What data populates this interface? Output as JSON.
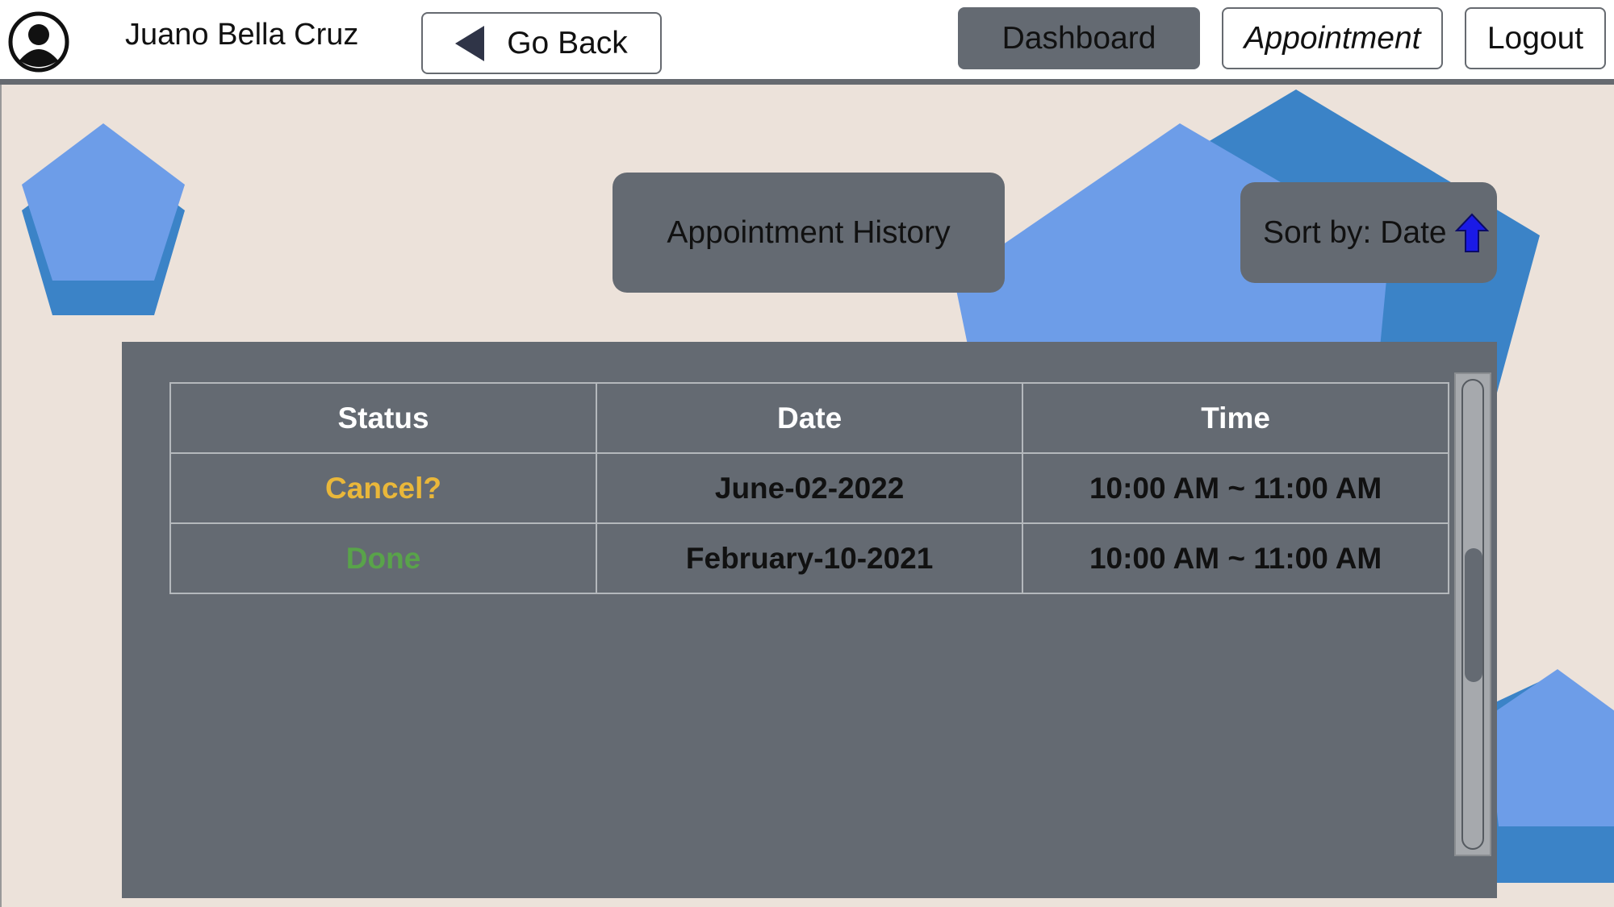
{
  "header": {
    "user_name": "Juano Bella Cruz",
    "go_back_label": "Go Back",
    "nav": {
      "dashboard_label": "Dashboard",
      "appointment_label": "Appointment",
      "logout_label": "Logout"
    }
  },
  "page": {
    "title": "Appointment History",
    "sort_label": "Sort by: Date"
  },
  "table": {
    "columns": [
      "Status",
      "Date",
      "Time"
    ],
    "rows": [
      {
        "status": "Cancel?",
        "date": "June-02-2022",
        "time": "10:00 AM ~ 11:00 AM"
      },
      {
        "status": "Done",
        "date": "February-10-2021",
        "time": "10:00 AM ~ 11:00 AM"
      }
    ]
  },
  "colors": {
    "cancel_status": "#e9b73a",
    "done_status": "#59a34a",
    "panel": "#646a72",
    "background": "#ece2da",
    "pentagon_light": "#6d9de8",
    "pentagon_dark": "#3b83c7",
    "sort_arrow": "#1a1ae6"
  },
  "icons": {
    "avatar": "user-avatar-icon",
    "go_back": "back-triangle-icon",
    "sort": "arrow-up-icon"
  }
}
